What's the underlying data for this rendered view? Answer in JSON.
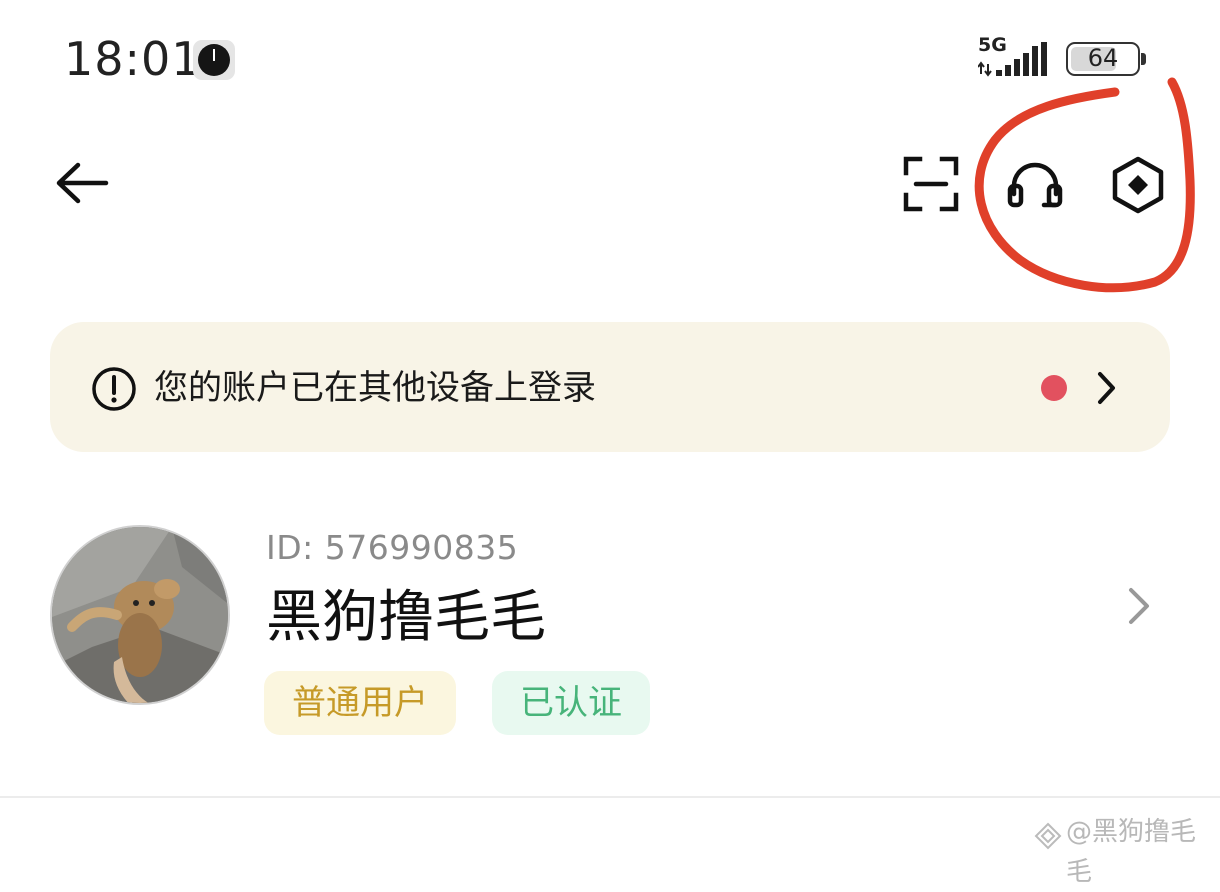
{
  "status_bar": {
    "time": "18:01",
    "network": "5G",
    "battery": "64",
    "battery_level": 0.64
  },
  "nav": {
    "back_icon": "back-arrow-icon",
    "scan_icon": "scan-icon",
    "support_icon": "headset-icon",
    "settings_icon": "hexagon-settings-icon"
  },
  "notice": {
    "icon": "exclamation-circle-icon",
    "text": "您的账户已在其他设备上登录",
    "dot_color": "#e2515f"
  },
  "profile": {
    "id_text": "ID: 576990835",
    "name": "黑狗撸毛毛",
    "badges": [
      {
        "label": "普通用户",
        "color": "#c69a28",
        "bg": "#fbf6df"
      },
      {
        "label": "已认证",
        "color": "#47b47a",
        "bg": "#e8f9f0"
      }
    ]
  },
  "watermark": {
    "text": "@黑狗撸毛毛"
  },
  "colors": {
    "banner_bg": "#f8f4e7",
    "annotation": "#e0402a"
  }
}
